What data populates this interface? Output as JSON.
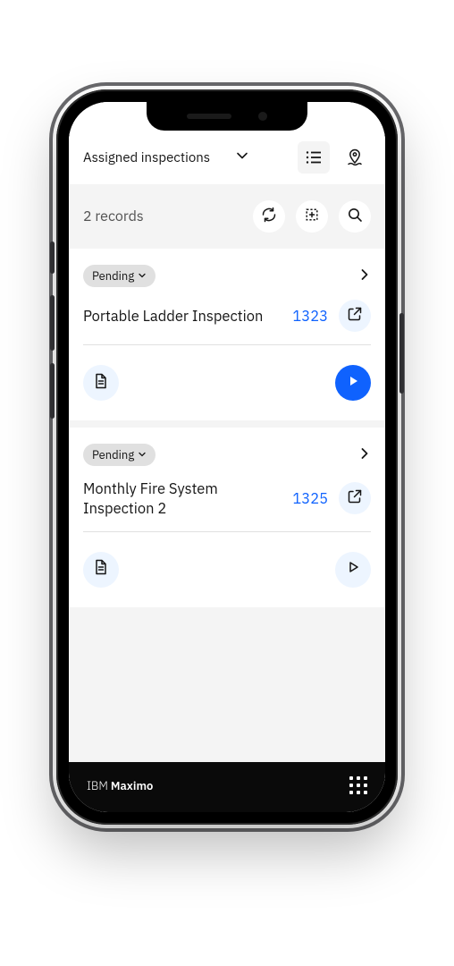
{
  "header": {
    "dropdown_label": "Assigned inspections"
  },
  "banner": {
    "text": "2 records"
  },
  "cards": [
    {
      "status": "Pending",
      "title": "Portable Ladder Inspection",
      "id": "1323",
      "primary_play": true
    },
    {
      "status": "Pending",
      "title": "Monthly Fire System Inspection 2",
      "id": "1325",
      "primary_play": false
    }
  ],
  "footer": {
    "brand_prefix": "IBM ",
    "brand_bold": "Maximo"
  },
  "colors": {
    "accent": "#0f62fe",
    "soft_accent_bg": "#edf5ff",
    "grey_bg": "#f4f4f4",
    "text": "#161616",
    "muted": "#525252"
  }
}
